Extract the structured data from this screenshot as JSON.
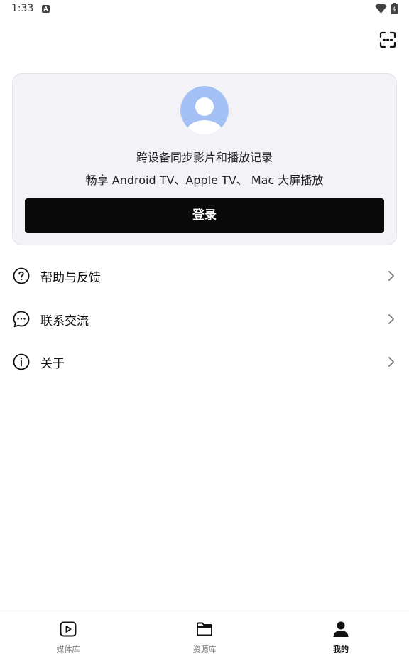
{
  "status_bar": {
    "time": "1:33",
    "app_icon_letter": "A"
  },
  "account_card": {
    "line1": "跨设备同步影片和播放记录",
    "line2": "畅享 Android TV、Apple TV、 Mac 大屏播放",
    "login_label": "登录",
    "avatar_color": "#a5c0f5"
  },
  "menu": {
    "items": [
      {
        "label": "帮助与反馈",
        "icon": "help-icon"
      },
      {
        "label": "联系交流",
        "icon": "chat-icon"
      },
      {
        "label": "关于",
        "icon": "info-icon"
      }
    ]
  },
  "bottom_nav": {
    "items": [
      {
        "label": "媒体库",
        "icon": "play-icon",
        "active": false
      },
      {
        "label": "资源库",
        "icon": "folder-icon",
        "active": false
      },
      {
        "label": "我的",
        "icon": "user-icon",
        "active": true
      }
    ]
  },
  "colors": {
    "accent": "#0a0a0a",
    "card_background": "#f2f2f7"
  }
}
